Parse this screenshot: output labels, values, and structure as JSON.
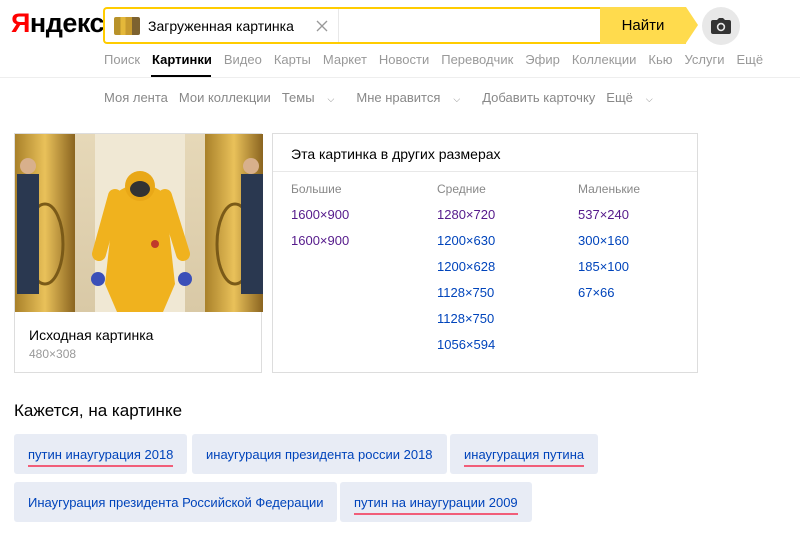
{
  "header": {
    "logo_prefix": "Я",
    "logo_rest": "ндекс",
    "search_chip": "Загруженная картинка",
    "search_button": "Найти"
  },
  "nav": [
    "Поиск",
    "Картинки",
    "Видео",
    "Карты",
    "Маркет",
    "Новости",
    "Переводчик",
    "Эфир",
    "Коллекции",
    "Кью",
    "Услуги",
    "Ещё"
  ],
  "nav_active": "Картинки",
  "subnav": {
    "feed": "Моя лента",
    "collections": "Мои коллекции",
    "themes": "Темы",
    "likes": "Мне нравится",
    "add_card": "Добавить карточку",
    "more": "Ещё"
  },
  "original": {
    "title": "Исходная картинка",
    "size": "480×308"
  },
  "sizes": {
    "title": "Эта картинка в других размерах",
    "large_label": "Большие",
    "medium_label": "Средние",
    "small_label": "Маленькие",
    "large": [
      "1600×900",
      "1600×900"
    ],
    "medium": [
      "1280×720",
      "1200×630",
      "1200×628",
      "1128×750",
      "1128×750",
      "1056×594"
    ],
    "small": [
      "537×240",
      "300×160",
      "185×100",
      "67×66"
    ]
  },
  "tags": {
    "title": "Кажется, на картинке",
    "items": [
      "путин инаугурация 2018",
      "инаугурация президента россии 2018",
      "инаугурация путина",
      "Инаугурация президента Российской Федерации",
      "путин на инаугурации 2009"
    ]
  },
  "colors": {
    "accent": "#ffdb4d",
    "link": "#0044bb",
    "visited": "#551a8b",
    "tag_bg": "#e8ecf5"
  }
}
